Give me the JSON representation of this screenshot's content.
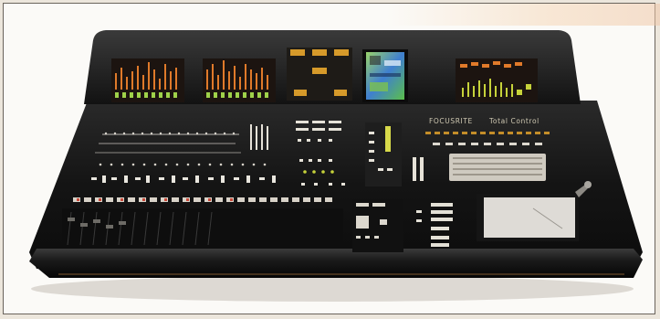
{
  "photo": {
    "subject": "mixing-console",
    "brand_left": "FOCUSRITE",
    "brand_right": "Total Control",
    "colors": {
      "frame_border": "#6a645c",
      "console_body": "#141414",
      "meter_orange": "#e07a2a",
      "meter_green": "#9fd24a",
      "lamp_amber": "#d69a2a",
      "screen_green": "#7cc24f",
      "screen_blue": "#3f7fd0",
      "touchpad": "#dedbd6"
    }
  }
}
